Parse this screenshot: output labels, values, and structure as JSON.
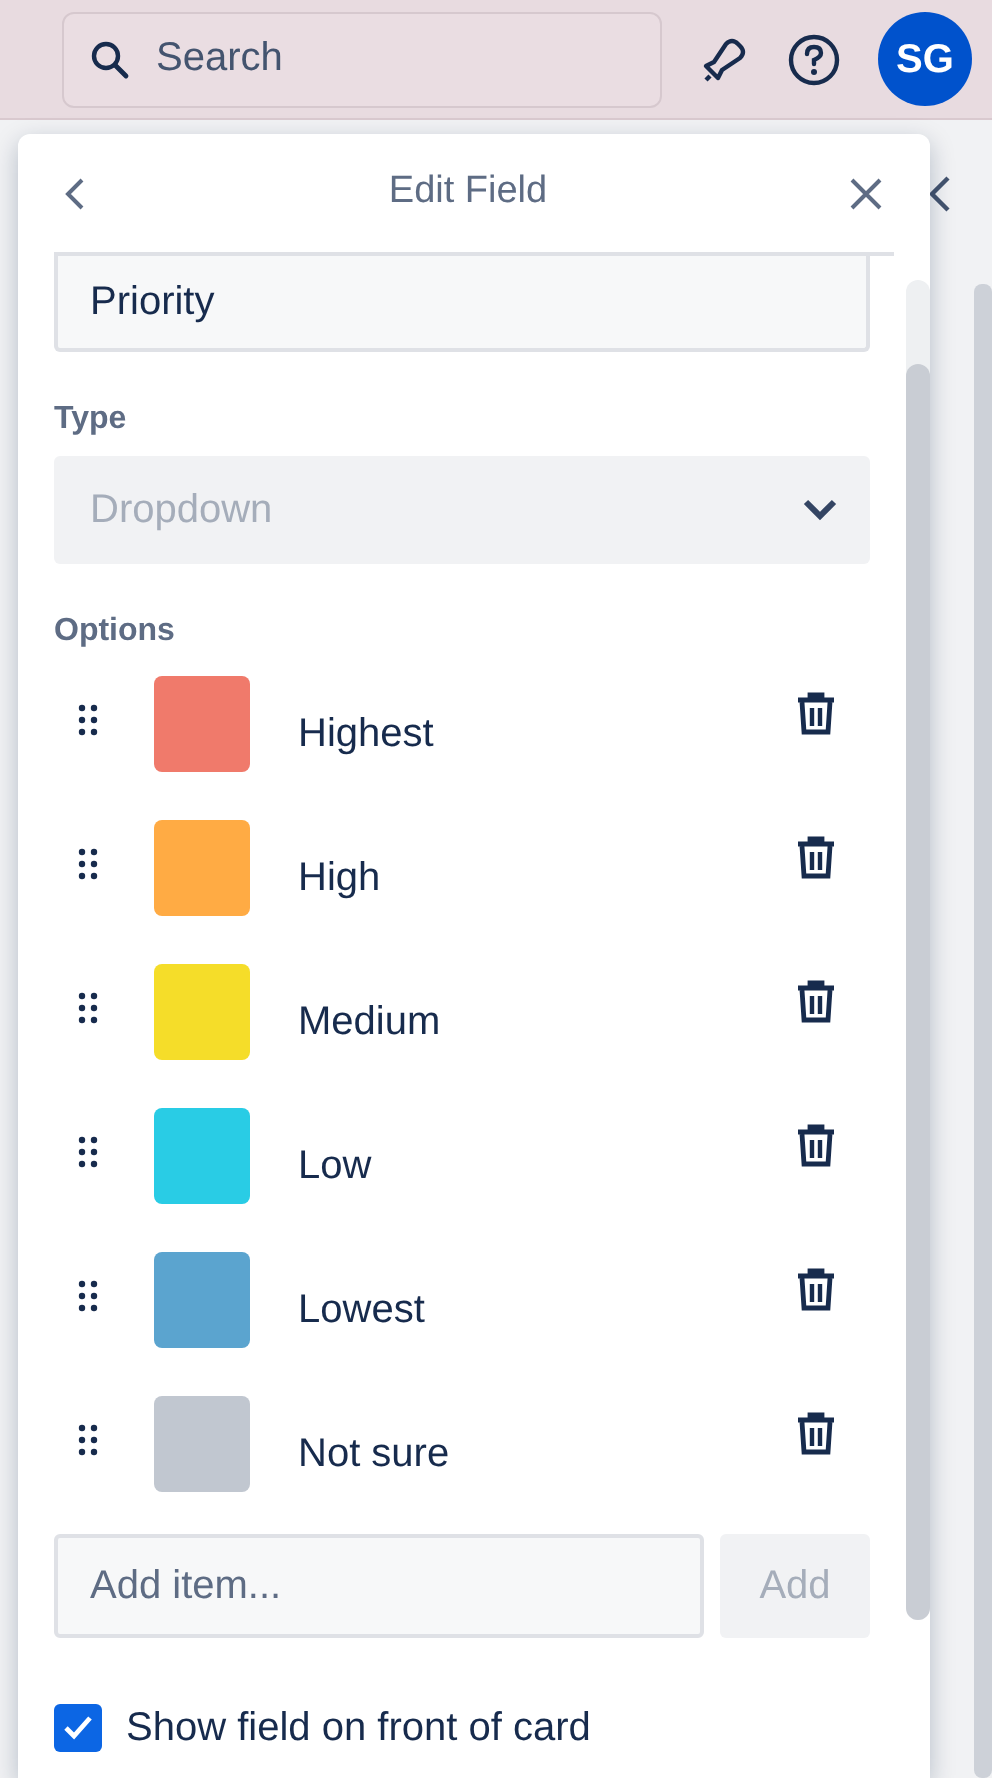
{
  "header": {
    "search": {
      "placeholder": "Search"
    },
    "avatar": "SG"
  },
  "popover": {
    "title": "Edit Field",
    "name_value": "Priority",
    "type_label": "Type",
    "type_value": "Dropdown",
    "options_label": "Options",
    "options": [
      {
        "label": "Highest",
        "color": "#f07a6b"
      },
      {
        "label": "High",
        "color": "#ffab44"
      },
      {
        "label": "Medium",
        "color": "#f5dd29"
      },
      {
        "label": "Low",
        "color": "#29cce5"
      },
      {
        "label": "Lowest",
        "color": "#5ba4cf"
      },
      {
        "label": "Not sure",
        "color": "#c1c7d0"
      }
    ],
    "add_placeholder": "Add item...",
    "add_button": {
      "label": "Add",
      "disabled": true
    },
    "show_on_card": {
      "label": "Show field on front of card",
      "checked": true
    }
  }
}
